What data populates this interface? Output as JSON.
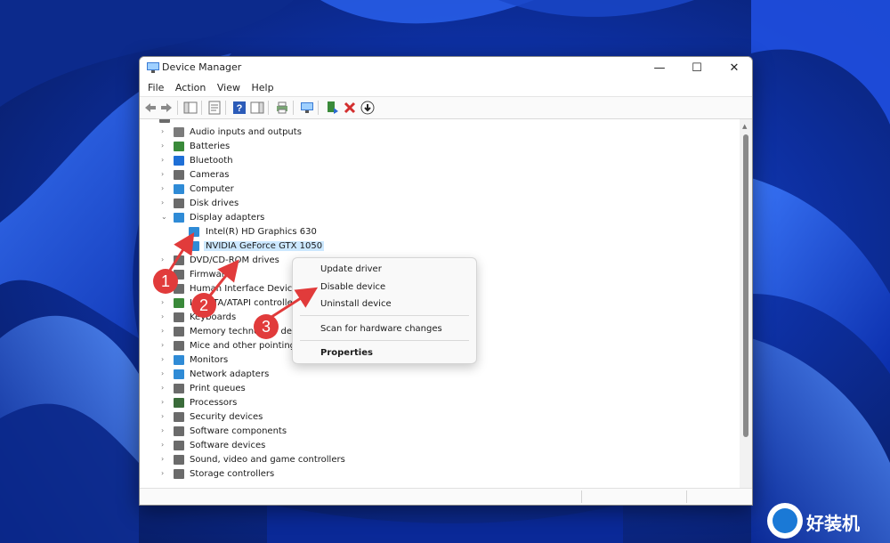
{
  "window": {
    "title": "Device Manager",
    "controls": {
      "minimize": "—",
      "maximize": "☐",
      "close": "✕"
    }
  },
  "menubar": [
    "File",
    "Action",
    "View",
    "Help"
  ],
  "toolbar": {
    "icons": [
      "back-icon",
      "forward-icon",
      "show-hide-console-tree-icon",
      "properties-icon",
      "help-icon",
      "action-pane-icon",
      "print-icon",
      "scan-hardware-icon",
      "update-driver-icon",
      "uninstall-icon",
      "disable-icon"
    ]
  },
  "tree": {
    "root_label": "···",
    "categories": [
      {
        "label": "Audio inputs and outputs",
        "icon": "speaker-icon",
        "color": "#7b7b7b"
      },
      {
        "label": "Batteries",
        "icon": "battery-icon",
        "color": "#3a8a3a"
      },
      {
        "label": "Bluetooth",
        "icon": "bluetooth-icon",
        "color": "#1f6fd6"
      },
      {
        "label": "Cameras",
        "icon": "camera-icon",
        "color": "#6b6b6b"
      },
      {
        "label": "Computer",
        "icon": "computer-icon",
        "color": "#2f8bd6"
      },
      {
        "label": "Disk drives",
        "icon": "disk-drive-icon",
        "color": "#6b6b6b"
      },
      {
        "label": "Display adapters",
        "icon": "display-adapter-icon",
        "color": "#2f8bd6",
        "expanded": true,
        "children": [
          {
            "label": "Intel(R) HD Graphics 630",
            "icon": "display-adapter-icon"
          },
          {
            "label": "NVIDIA GeForce GTX 1050",
            "icon": "display-adapter-icon",
            "selected": true
          }
        ]
      },
      {
        "label": "DVD/CD-ROM drives",
        "icon": "dvd-drive-icon",
        "color": "#6b6b6b"
      },
      {
        "label": "Firmware",
        "icon": "firmware-icon",
        "color": "#6b6b6b"
      },
      {
        "label": "Human Interface Devices",
        "icon": "hid-icon",
        "color": "#6b6b6b"
      },
      {
        "label": "IDE ATA/ATAPI controllers",
        "icon": "ide-controller-icon",
        "color": "#3a8a3a"
      },
      {
        "label": "Keyboards",
        "icon": "keyboard-icon",
        "color": "#6b6b6b"
      },
      {
        "label": "Memory technology devices",
        "icon": "memory-icon",
        "color": "#6b6b6b"
      },
      {
        "label": "Mice and other pointing devices",
        "icon": "mouse-icon",
        "color": "#6b6b6b"
      },
      {
        "label": "Monitors",
        "icon": "monitor-icon",
        "color": "#2f8bd6"
      },
      {
        "label": "Network adapters",
        "icon": "network-adapter-icon",
        "color": "#2f8bd6"
      },
      {
        "label": "Print queues",
        "icon": "printer-icon",
        "color": "#6b6b6b"
      },
      {
        "label": "Processors",
        "icon": "processor-icon",
        "color": "#3a6b3a"
      },
      {
        "label": "Security devices",
        "icon": "security-device-icon",
        "color": "#6b6b6b"
      },
      {
        "label": "Software components",
        "icon": "software-component-icon",
        "color": "#6b6b6b"
      },
      {
        "label": "Software devices",
        "icon": "software-device-icon",
        "color": "#6b6b6b"
      },
      {
        "label": "Sound, video and game controllers",
        "icon": "sound-controller-icon",
        "color": "#6b6b6b"
      },
      {
        "label": "Storage controllers",
        "icon": "storage-controller-icon",
        "color": "#6b6b6b"
      }
    ]
  },
  "context_menu": {
    "items": [
      "Update driver",
      "Disable device",
      "Uninstall device",
      "Scan for hardware changes",
      "Properties"
    ]
  },
  "annotations": {
    "badges": [
      "1",
      "2",
      "3"
    ],
    "color": "#e13b3b"
  },
  "watermark": {
    "text": "好装机",
    "icon": "watermark-logo-icon"
  }
}
